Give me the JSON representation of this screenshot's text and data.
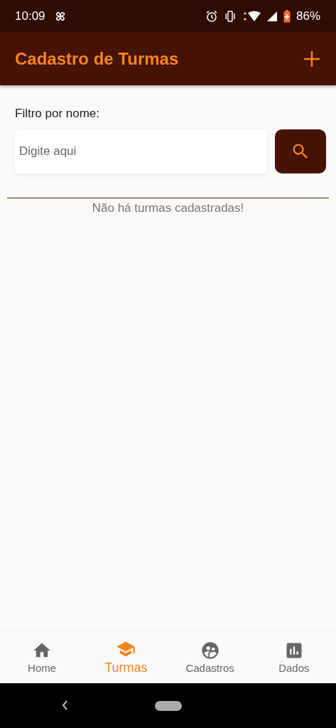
{
  "status_bar": {
    "time": "10:09",
    "battery": "86%"
  },
  "app_bar": {
    "title": "Cadastro de Turmas"
  },
  "filter": {
    "label": "Filtro por nome:",
    "placeholder": "Digite aqui"
  },
  "empty_message": "Não há turmas cadastradas!",
  "bottom_nav": [
    {
      "kind": "home",
      "label": "Home",
      "selected": false
    },
    {
      "kind": "school",
      "label": "Turmas",
      "selected": true
    },
    {
      "kind": "people",
      "label": "Cadastros",
      "selected": false
    },
    {
      "kind": "chart",
      "label": "Dados",
      "selected": false
    }
  ]
}
